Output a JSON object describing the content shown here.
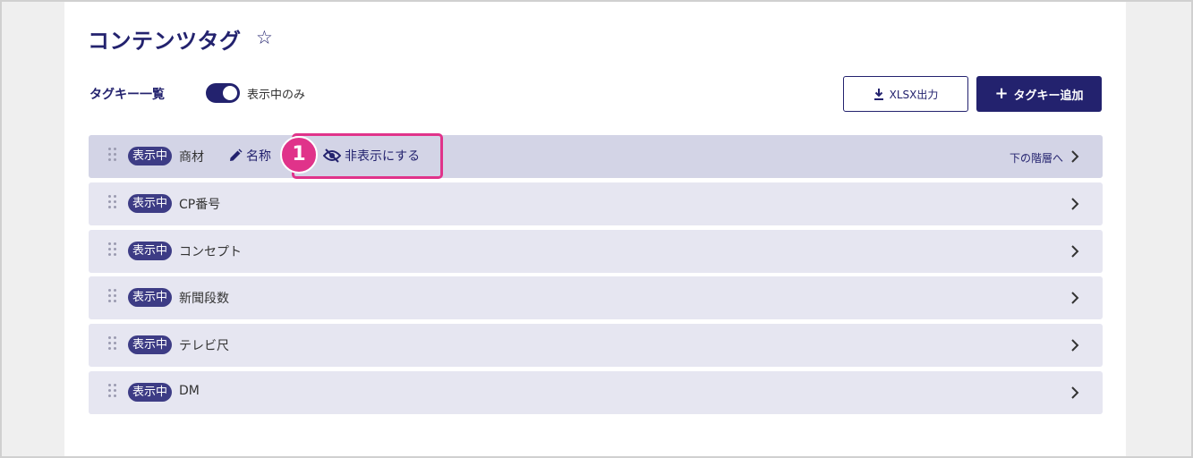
{
  "page": {
    "title": "コンテンツタグ",
    "favorite_icon": "star-outline-icon"
  },
  "toolbar": {
    "list_heading": "タグキー一覧",
    "toggle_label": "表示中のみ",
    "toggle_on": true,
    "export_label": "XLSX出力",
    "add_label": "タグキー追加"
  },
  "rows": [
    {
      "badge": "表示中",
      "label": "商材",
      "rename_label": "名称",
      "hide_label": "非表示にする",
      "next_label": "下の階層へ"
    },
    {
      "badge": "表示中",
      "label": "CP番号"
    },
    {
      "badge": "表示中",
      "label": "コンセプト"
    },
    {
      "badge": "表示中",
      "label": "新聞段数"
    },
    {
      "badge": "表示中",
      "label": "テレビ尺"
    },
    {
      "badge": "表示中",
      "label": "DM"
    }
  ],
  "annotation": {
    "step_number": "1"
  },
  "colors": {
    "primary": "#23226e",
    "badge": "#3d3c85",
    "row_bg": "#e6e6f1",
    "row_active_bg": "#d3d4e6",
    "annotation": "#e0338a"
  }
}
